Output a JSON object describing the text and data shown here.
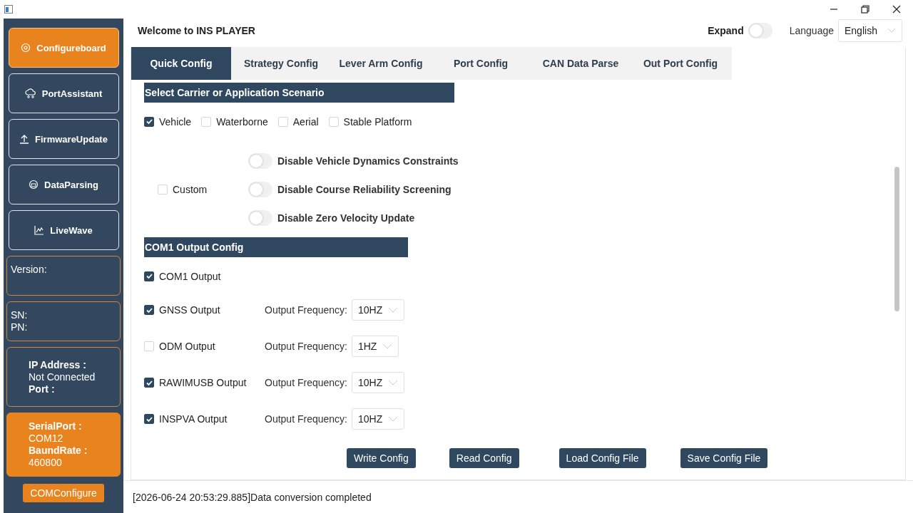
{
  "header": {
    "title": "Welcome to INS PLAYER",
    "expand": {
      "label": "Expand",
      "on": false
    },
    "language": {
      "label": "Language",
      "value": "English"
    }
  },
  "sidebar": {
    "nav": [
      {
        "label": "Configureboard",
        "selected": true
      },
      {
        "label": "PortAssistant",
        "selected": false
      },
      {
        "label": "FirmwareUpdate",
        "selected": false
      },
      {
        "label": "DataParsing",
        "selected": false
      },
      {
        "label": "LiveWave",
        "selected": false
      }
    ],
    "panels": [
      {
        "kind": "plain",
        "lines": [
          {
            "text": "Version:",
            "kind": "value"
          }
        ]
      },
      {
        "kind": "plain",
        "lines": [
          {
            "text": "SN:",
            "kind": "value"
          },
          {
            "text": "PN:",
            "kind": "value"
          }
        ]
      },
      {
        "kind": "plain",
        "lines": [
          {
            "text": "IP Address :",
            "kind": "heading"
          },
          {
            "text": "Not Connected",
            "kind": "value"
          },
          {
            "text": "Port :",
            "kind": "heading"
          }
        ]
      },
      {
        "kind": "accent",
        "lines": [
          {
            "text": "SerialPort :",
            "kind": "heading"
          },
          {
            "text": "COM12",
            "kind": "value"
          },
          {
            "text": "BaundRate :",
            "kind": "heading"
          },
          {
            "text": "460800",
            "kind": "value"
          }
        ]
      }
    ],
    "button": "COMConfigure"
  },
  "tabs": [
    {
      "label": "Quick Config",
      "selected": true
    },
    {
      "label": "Strategy Config",
      "selected": false
    },
    {
      "label": "Lever Arm Config",
      "selected": false
    },
    {
      "label": "Port Config",
      "selected": false
    },
    {
      "label": "CAN Data Parse",
      "selected": false
    },
    {
      "label": "Out Port Config",
      "selected": false
    }
  ],
  "scenario": {
    "title": "Select Carrier or Application Scenario",
    "options": [
      {
        "label": "Vehicle",
        "checked": true
      },
      {
        "label": "Waterborne",
        "checked": false
      },
      {
        "label": "Aerial",
        "checked": false
      },
      {
        "label": "Stable Platform",
        "checked": false
      }
    ],
    "custom": {
      "label": "Custom",
      "checked": false
    },
    "switches": [
      {
        "label": "Disable Vehicle Dynamics Constraints",
        "on": false
      },
      {
        "label": "Disable Course Reliability Screening",
        "on": false
      },
      {
        "label": "Disable Zero Velocity Update",
        "on": false
      }
    ]
  },
  "com1": {
    "title": "COM1 Output Config",
    "outputs": [
      {
        "label": "COM1 Output",
        "checked": true
      },
      {
        "label": "GNSS Output",
        "checked": true,
        "frequency_label": "Output Frequency:",
        "frequency": "10HZ"
      },
      {
        "label": "ODM Output",
        "checked": false,
        "frequency_label": "Output Frequency:",
        "frequency": "1HZ"
      },
      {
        "label": "RAWIMUSB Output",
        "checked": true,
        "frequency_label": "Output Frequency:",
        "frequency": "10HZ"
      },
      {
        "label": "INSPVA Output",
        "checked": true,
        "frequency_label": "Output Frequency:",
        "frequency": "10HZ"
      }
    ]
  },
  "buttons": [
    "Write Config",
    "Read Config",
    "Load Config File",
    "Save Config File"
  ],
  "status": "[2026-06-24 20:53:29.885]Data conversion completed"
}
